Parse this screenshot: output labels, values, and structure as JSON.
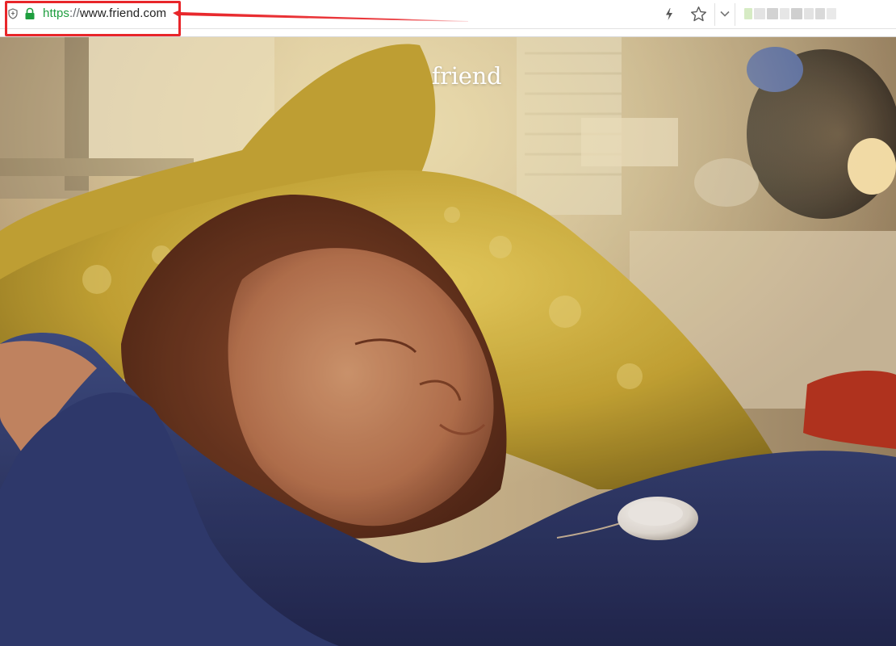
{
  "browser": {
    "url_scheme": "https",
    "url_separator": "://",
    "url_host": "www.friend.com",
    "icons": [
      "shield-icon",
      "lock-icon",
      "bolt-icon",
      "star-icon",
      "chevron-down-icon"
    ],
    "annotation_color": "#e8262a",
    "secure_color": "#1e9e3e"
  },
  "hero": {
    "brand": "friend"
  }
}
